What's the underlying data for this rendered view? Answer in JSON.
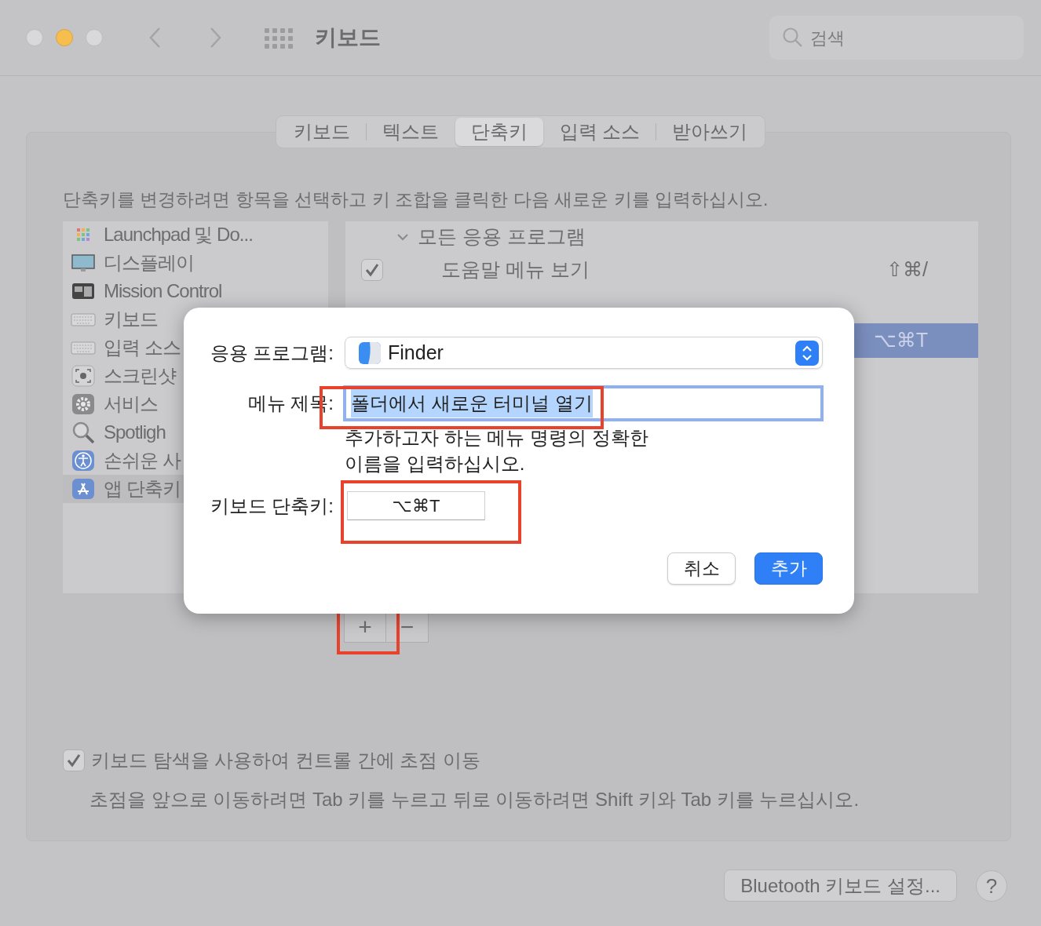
{
  "window": {
    "title": "키보드",
    "search": {
      "placeholder": "검색"
    }
  },
  "tabs": [
    {
      "label": "키보드",
      "selected": false
    },
    {
      "label": "텍스트",
      "selected": false
    },
    {
      "label": "단축키",
      "selected": true
    },
    {
      "label": "입력 소스",
      "selected": false
    },
    {
      "label": "받아쓰기",
      "selected": false
    }
  ],
  "instructions": "단축키를 변경하려면 항목을 선택하고 키 조합을 클릭한 다음 새로운 키를 입력하십시오.",
  "sidebar": {
    "items": [
      {
        "label": "Launchpad 및 Do...",
        "selected": false
      },
      {
        "label": "디스플레이",
        "selected": false
      },
      {
        "label": "Mission Control",
        "selected": false
      },
      {
        "label": "키보드",
        "selected": false
      },
      {
        "label": "입력 소스",
        "selected": false
      },
      {
        "label": "스크린샷",
        "selected": false
      },
      {
        "label": "서비스",
        "selected": false
      },
      {
        "label": "Spotligh",
        "selected": false
      },
      {
        "label": "손쉬운 사",
        "selected": false
      },
      {
        "label": "앱 단축키",
        "selected": true
      }
    ]
  },
  "shortcuts": {
    "rows": [
      {
        "kind": "group",
        "label": "모든 응용 프로그램",
        "expanded": true
      },
      {
        "kind": "item",
        "checked": true,
        "label": "도움말 메뉴 보기",
        "shortcut": "⇧⌘/",
        "selected": false
      },
      {
        "kind": "group"
      },
      {
        "kind": "item",
        "shortcut": "⌥⌘T",
        "selected": true
      }
    ]
  },
  "add_remove": {
    "add": "+",
    "remove": "−",
    "add_highlighted": true
  },
  "keyboard_navigation": {
    "checked": true,
    "label": "키보드 탐색을 사용하여 컨트롤 간에 초점 이동",
    "description": "초점을 앞으로 이동하려면 Tab 키를 누르고 뒤로 이동하려면 Shift 키와 Tab 키를 누르십시오."
  },
  "bluetooth_button": "Bluetooth 키보드 설정...",
  "help_button": "?",
  "dialog": {
    "app_label": "응용 프로그램:",
    "app": "Finder",
    "menu_title_label": "메뉴 제목:",
    "menu_title": "폴더에서 새로운 터미널 열기",
    "menu_title_highlighted": true,
    "hint": "추가하고자 하는 메뉴 명령의 정확한\n이름을 입력하십시오.",
    "shortcut_label": "키보드 단축키:",
    "shortcut": "⌥⌘T",
    "shortcut_highlighted": true,
    "buttons": [
      {
        "label": "취소",
        "kind": "default"
      },
      {
        "label": "추가",
        "kind": "primary"
      }
    ]
  }
}
